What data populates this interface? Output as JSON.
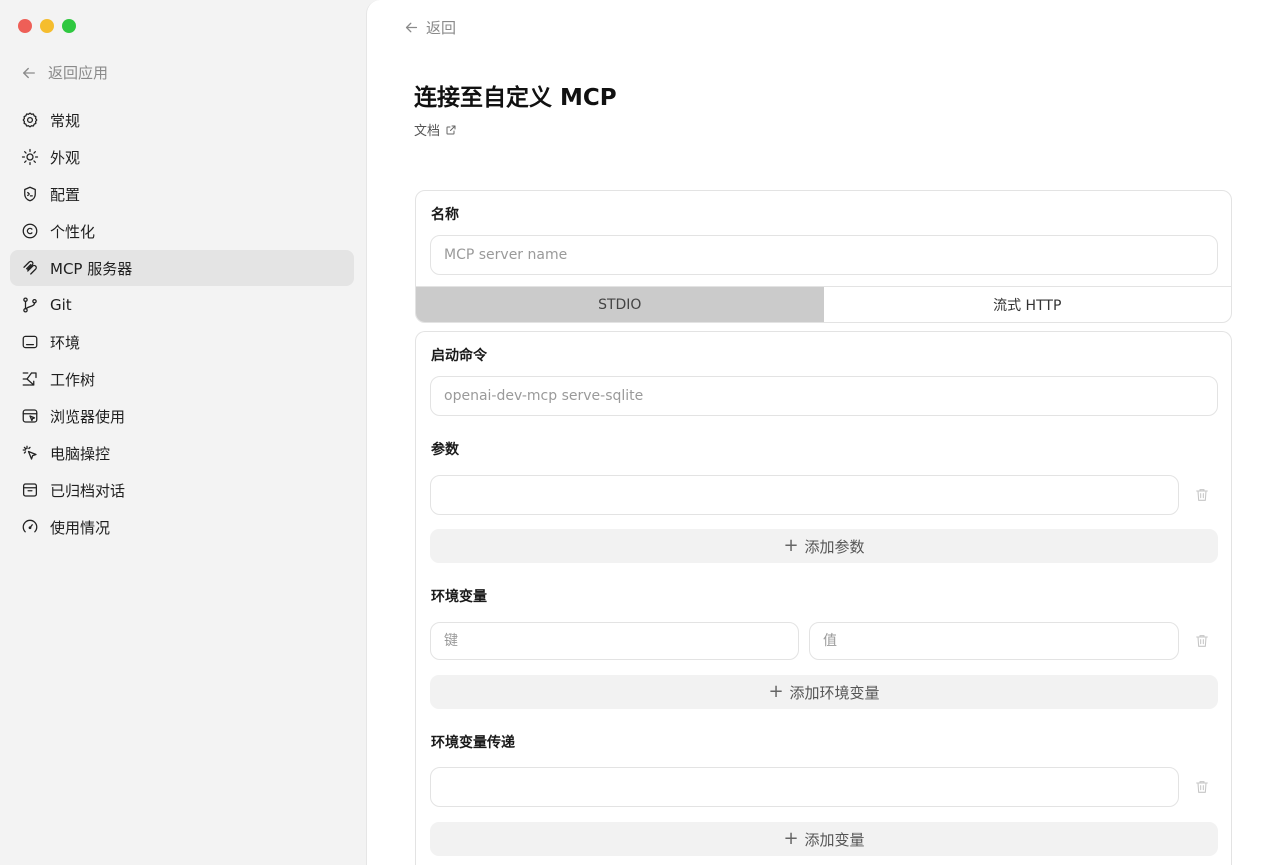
{
  "window": {
    "traffic": {
      "close": "#ee5f57",
      "minimize": "#f5bd2e",
      "zoom": "#2fc840"
    }
  },
  "sidebar": {
    "back_label": "返回应用",
    "items": [
      {
        "label": "常规",
        "icon": "gear-icon"
      },
      {
        "label": "外观",
        "icon": "sun-icon"
      },
      {
        "label": "配置",
        "icon": "shield-terminal-icon"
      },
      {
        "label": "个性化",
        "icon": "personalization-icon"
      },
      {
        "label": "MCP 服务器",
        "icon": "mcp-icon",
        "active": true
      },
      {
        "label": "Git",
        "icon": "git-branch-icon"
      },
      {
        "label": "环境",
        "icon": "environment-icon"
      },
      {
        "label": "工作树",
        "icon": "worktree-icon"
      },
      {
        "label": "浏览器使用",
        "icon": "browser-icon"
      },
      {
        "label": "电脑操控",
        "icon": "cursor-click-icon"
      },
      {
        "label": "已归档对话",
        "icon": "archive-icon"
      },
      {
        "label": "使用情况",
        "icon": "gauge-icon"
      }
    ]
  },
  "main": {
    "back_label": "返回",
    "title": "连接至自定义 MCP",
    "docs_label": "文档",
    "name_section": {
      "label": "名称",
      "placeholder": "MCP server name",
      "value": ""
    },
    "transport_tabs": [
      {
        "label": "STDIO",
        "active": true
      },
      {
        "label": "流式 HTTP",
        "active": false
      }
    ],
    "command_section": {
      "label": "启动命令",
      "placeholder": "openai-dev-mcp serve-sqlite",
      "value": ""
    },
    "args_section": {
      "label": "参数",
      "add_label": "添加参数"
    },
    "env_section": {
      "label": "环境变量",
      "key_placeholder": "键",
      "value_placeholder": "值",
      "add_label": "添加环境变量"
    },
    "passthrough_section": {
      "label": "环境变量传递",
      "add_label": "添加变量"
    }
  }
}
